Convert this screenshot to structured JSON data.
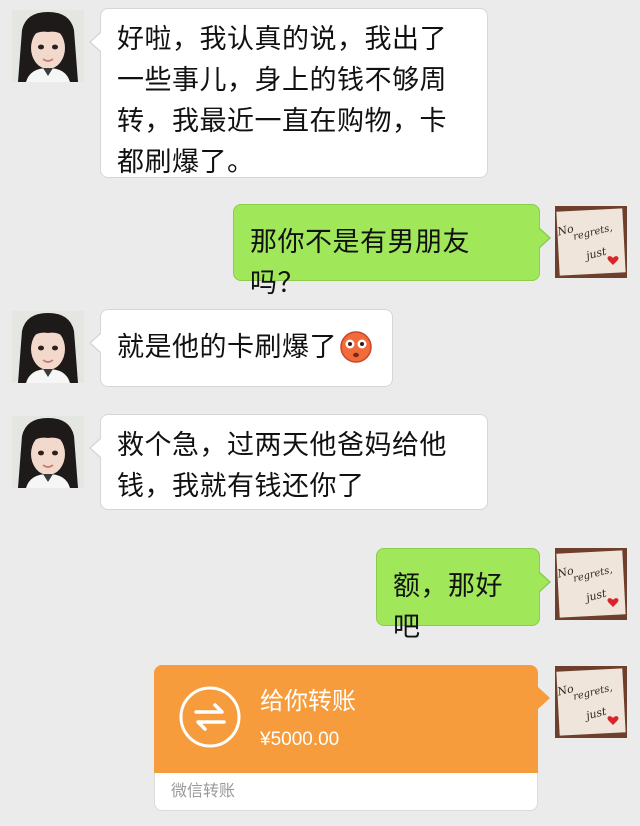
{
  "messages": [
    {
      "side": "in",
      "text": "好啦，我认真的说，我出了一些事儿，身上的钱不够周转，我最近一直在购物，卡都刷爆了。"
    },
    {
      "side": "out",
      "text": "那你不是有男朋友吗？"
    },
    {
      "side": "in",
      "text": "就是他的卡刷爆了",
      "emoji": "flushed-face-emoji"
    },
    {
      "side": "in",
      "text": "救个急，过两天他爸妈给他钱，我就有钱还你了"
    },
    {
      "side": "out",
      "text": "额，那好吧"
    }
  ],
  "transfer": {
    "title": "给你转账",
    "amount": "¥5000.00",
    "label": "微信转账",
    "icon": "transfer-arrows-icon",
    "color": "#f79c3c"
  },
  "avatars": {
    "left": "girl-photo-avatar",
    "right_text": "No regrets, just",
    "right_icon": "heart-icon"
  },
  "colors": {
    "background": "#ebebeb",
    "incoming_bubble": "#ffffff",
    "outgoing_bubble": "#a0e75a"
  }
}
